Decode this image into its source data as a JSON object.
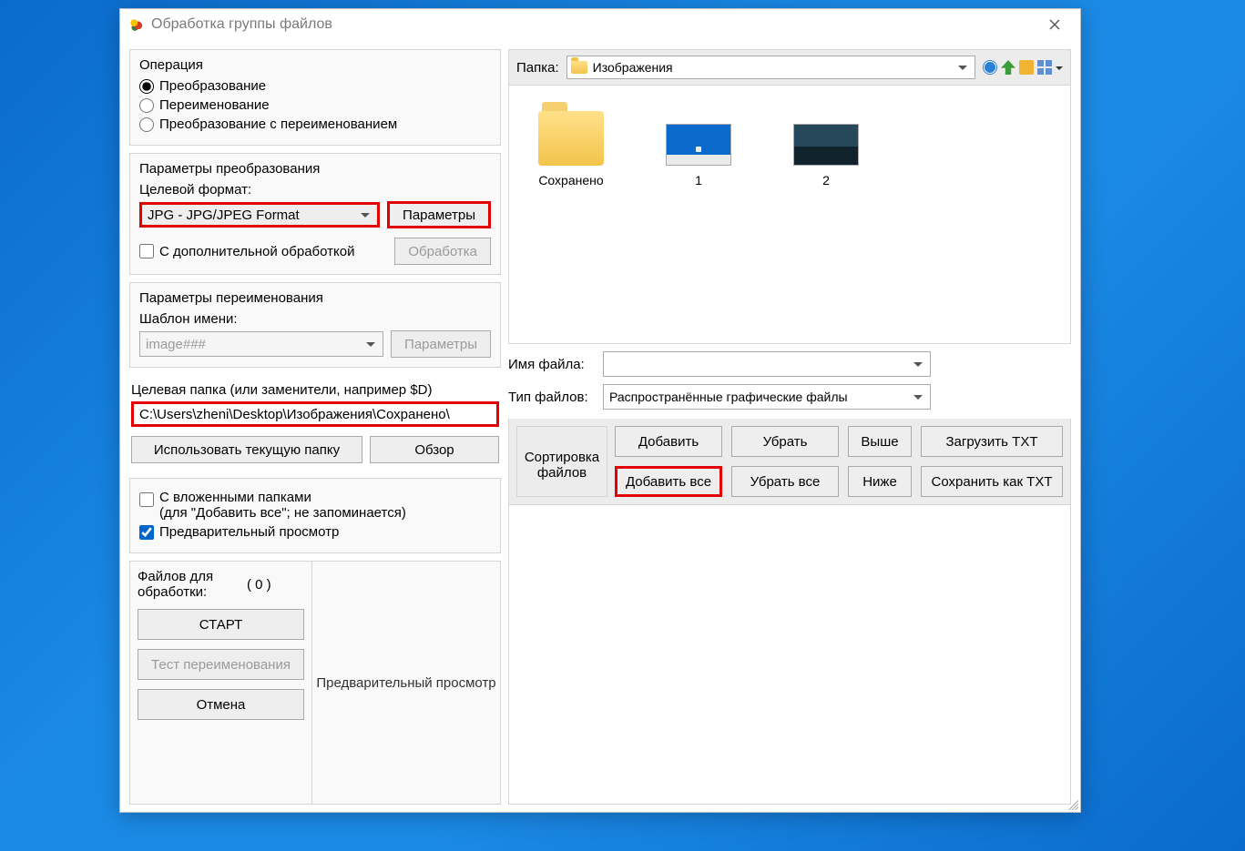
{
  "window": {
    "title": "Обработка группы файлов"
  },
  "operation": {
    "group_title": "Операция",
    "opt_convert": "Преобразование",
    "opt_rename": "Переименование",
    "opt_convert_rename": "Преобразование с переименованием",
    "selected": "convert"
  },
  "convert_params": {
    "group_title": "Параметры преобразования",
    "target_format_label": "Целевой формат:",
    "target_format_value": "JPG - JPG/JPEG Format",
    "params_button": "Параметры",
    "with_processing_label": "С дополнительной обработкой",
    "with_processing_checked": false,
    "processing_button": "Обработка"
  },
  "rename_params": {
    "group_title": "Параметры переименования",
    "name_template_label": "Шаблон имени:",
    "name_template_value": "image###",
    "params_button": "Параметры"
  },
  "target_folder": {
    "label": "Целевая папка (или заменители, например $D)",
    "path": "C:\\Users\\zheni\\Desktop\\Изображения\\Сохранено\\",
    "use_current_button": "Использовать текущую папку",
    "browse_button": "Обзор"
  },
  "options": {
    "subfolders_label": "С вложенными папками\n(для \"Добавить все\"; не запоминается)",
    "subfolders_checked": false,
    "preview_label": "Предварительный просмотр",
    "preview_checked": true
  },
  "run": {
    "files_for_processing_label": "Файлов для обработки:",
    "files_count": "( 0 )",
    "start_button": "СТАРТ",
    "test_rename_button": "Тест переименования",
    "cancel_button": "Отмена",
    "preview_panel_title": "Предварительный просмотр"
  },
  "browser": {
    "folder_label": "Папка:",
    "folder_selected": "Изображения",
    "thumbs": [
      {
        "name": "Сохранено",
        "kind": "folder"
      },
      {
        "name": "1",
        "kind": "pic1"
      },
      {
        "name": "2",
        "kind": "pic2"
      }
    ],
    "filename_label": "Имя файла:",
    "filename_value": "",
    "filetype_label": "Тип файлов:",
    "filetype_value": "Распространённые графические файлы"
  },
  "actions": {
    "sort_label": "Сортировка файлов",
    "add": "Добавить",
    "remove": "Убрать",
    "up": "Выше",
    "load_txt": "Загрузить TXT",
    "add_all": "Добавить все",
    "remove_all": "Убрать все",
    "down": "Ниже",
    "save_txt": "Сохранить как TXT"
  }
}
